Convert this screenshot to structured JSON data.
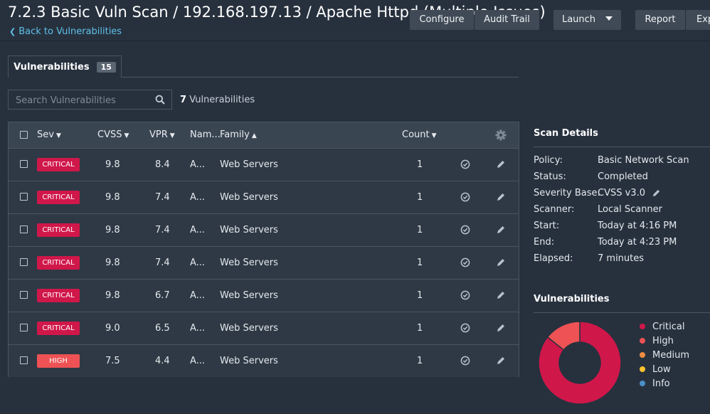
{
  "header": {
    "title": "7.2.3 Basic Vuln Scan / 192.168.197.13 / Apache Httpd (Multiple Issues)",
    "back_label": "Back to Vulnerabilities",
    "buttons": {
      "configure": "Configure",
      "audit_trail": "Audit Trail",
      "launch": "Launch",
      "report": "Report",
      "export": "Export"
    }
  },
  "tabs": [
    {
      "label": "Vulnerabilities",
      "count": "15"
    }
  ],
  "search": {
    "placeholder": "Search Vulnerabilities"
  },
  "vuln_count": {
    "number": "7",
    "label": "Vulnerabilities"
  },
  "table": {
    "columns": {
      "sev": "Sev",
      "cvss": "CVSS",
      "vpr": "VPR",
      "name": "Nam...",
      "family": "Family",
      "count": "Count"
    },
    "rows": [
      {
        "sev": "CRITICAL",
        "level": "critical",
        "cvss": "9.8",
        "vpr": "8.4",
        "name": "A...",
        "family": "Web Servers",
        "count": "1"
      },
      {
        "sev": "CRITICAL",
        "level": "critical",
        "cvss": "9.8",
        "vpr": "7.4",
        "name": "A...",
        "family": "Web Servers",
        "count": "1"
      },
      {
        "sev": "CRITICAL",
        "level": "critical",
        "cvss": "9.8",
        "vpr": "7.4",
        "name": "A...",
        "family": "Web Servers",
        "count": "1"
      },
      {
        "sev": "CRITICAL",
        "level": "critical",
        "cvss": "9.8",
        "vpr": "7.4",
        "name": "A...",
        "family": "Web Servers",
        "count": "1"
      },
      {
        "sev": "CRITICAL",
        "level": "critical",
        "cvss": "9.8",
        "vpr": "6.7",
        "name": "A...",
        "family": "Web Servers",
        "count": "1"
      },
      {
        "sev": "CRITICAL",
        "level": "critical",
        "cvss": "9.0",
        "vpr": "6.5",
        "name": "A...",
        "family": "Web Servers",
        "count": "1"
      },
      {
        "sev": "HIGH",
        "level": "high",
        "cvss": "7.5",
        "vpr": "4.4",
        "name": "A...",
        "family": "Web Servers",
        "count": "1"
      }
    ]
  },
  "scan_details": {
    "heading": "Scan Details",
    "items": [
      {
        "label": "Policy:",
        "value": "Basic Network Scan"
      },
      {
        "label": "Status:",
        "value": "Completed"
      },
      {
        "label": "Severity Base:",
        "value": "CVSS v3.0"
      },
      {
        "label": "Scanner:",
        "value": "Local Scanner"
      },
      {
        "label": "Start:",
        "value": "Today at 4:16 PM"
      },
      {
        "label": "End:",
        "value": "Today at 4:23 PM"
      },
      {
        "label": "Elapsed:",
        "value": "7 minutes"
      }
    ]
  },
  "vuln_chart": {
    "heading": "Vulnerabilities",
    "legend": [
      "Critical",
      "High",
      "Medium",
      "Low",
      "Info"
    ]
  },
  "chart_data": {
    "type": "pie",
    "categories": [
      "Critical",
      "High",
      "Medium",
      "Low",
      "Info"
    ],
    "values": [
      6,
      1,
      0,
      0,
      0
    ],
    "colors": [
      "#d0174a",
      "#ee5254",
      "#f18c43",
      "#fdc431",
      "#4a90c8"
    ]
  },
  "colors": {
    "background": "#27313e",
    "critical": "#d0174a",
    "high": "#ee5254",
    "medium": "#f18c43",
    "low": "#fdc431",
    "info": "#4a90c8",
    "link": "#5fc0e8"
  }
}
